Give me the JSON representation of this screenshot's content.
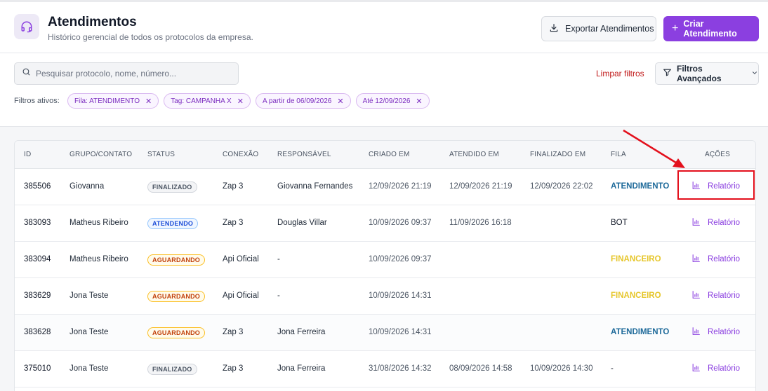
{
  "header": {
    "title": "Atendimentos",
    "subtitle": "Histórico gerencial de todos os protocolos da empresa.",
    "export_label": "Exportar Atendimentos",
    "create_label": "Criar Atendimento",
    "icon": "headset-icon"
  },
  "filters": {
    "search_placeholder": "Pesquisar protocolo, nome, número...",
    "clear_label": "Limpar filtros",
    "advanced_label": "Filtros Avançados",
    "active_label": "Filtros ativos:",
    "chips": [
      {
        "label": "Fila: ATENDIMENTO"
      },
      {
        "label": "Tag: CAMPANHA X"
      },
      {
        "label": "A partir de 06/09/2026"
      },
      {
        "label": "Até 12/09/2026"
      }
    ]
  },
  "table": {
    "headers": {
      "id": "ID",
      "contato": "GRUPO/CONTATO",
      "status": "STATUS",
      "conexao": "CONEXÃO",
      "responsavel": "RESPONSÁVEL",
      "criado": "CRIADO EM",
      "atendido": "ATENDIDO EM",
      "finalizado": "FINALIZADO EM",
      "fila": "FILA",
      "acoes": "AÇÕES"
    },
    "rows": [
      {
        "id": "385506",
        "contato": "Giovanna",
        "status": "FINALIZADO",
        "conexao": "Zap 3",
        "responsavel": "Giovanna Fernandes",
        "criado": "12/09/2026 21:19",
        "atendido": "12/09/2026 21:19",
        "finalizado": "12/09/2026 22:02",
        "fila": "ATENDIMENTO",
        "acao": "Relatório"
      },
      {
        "id": "383093",
        "contato": "Matheus Ribeiro",
        "status": "ATENDENDO",
        "conexao": "Zap 3",
        "responsavel": "Douglas Villar",
        "criado": "10/09/2026 09:37",
        "atendido": "11/09/2026 16:18",
        "finalizado": "",
        "fila": "BOT",
        "acao": "Relatório"
      },
      {
        "id": "383094",
        "contato": "Matheus Ribeiro",
        "status": "AGUARDANDO",
        "conexao": "Api Oficial",
        "responsavel": "-",
        "criado": "10/09/2026 09:37",
        "atendido": "",
        "finalizado": "",
        "fila": "FINANCEIRO",
        "acao": "Relatório"
      },
      {
        "id": "383629",
        "contato": "Jona Teste",
        "status": "AGUARDANDO",
        "conexao": "Api Oficial",
        "responsavel": "-",
        "criado": "10/09/2026 14:31",
        "atendido": "",
        "finalizado": "",
        "fila": "FINANCEIRO",
        "acao": "Relatório"
      },
      {
        "id": "383628",
        "contato": "Jona Teste",
        "status": "AGUARDANDO",
        "conexao": "Zap 3",
        "responsavel": "Jona Ferreira",
        "criado": "10/09/2026 14:31",
        "atendido": "",
        "finalizado": "",
        "fila": "ATENDIMENTO",
        "acao": "Relatório"
      },
      {
        "id": "375010",
        "contato": "Jona Teste",
        "status": "FINALIZADO",
        "conexao": "Zap 3",
        "responsavel": "Jona Ferreira",
        "criado": "31/08/2026 14:32",
        "atendido": "08/09/2026 14:58",
        "finalizado": "10/09/2026 14:30",
        "fila": "-",
        "acao": "Relatório"
      }
    ]
  },
  "colors": {
    "accent": "#8b3fe0",
    "highlight": "#e3101c",
    "clear_link": "#c01818"
  }
}
